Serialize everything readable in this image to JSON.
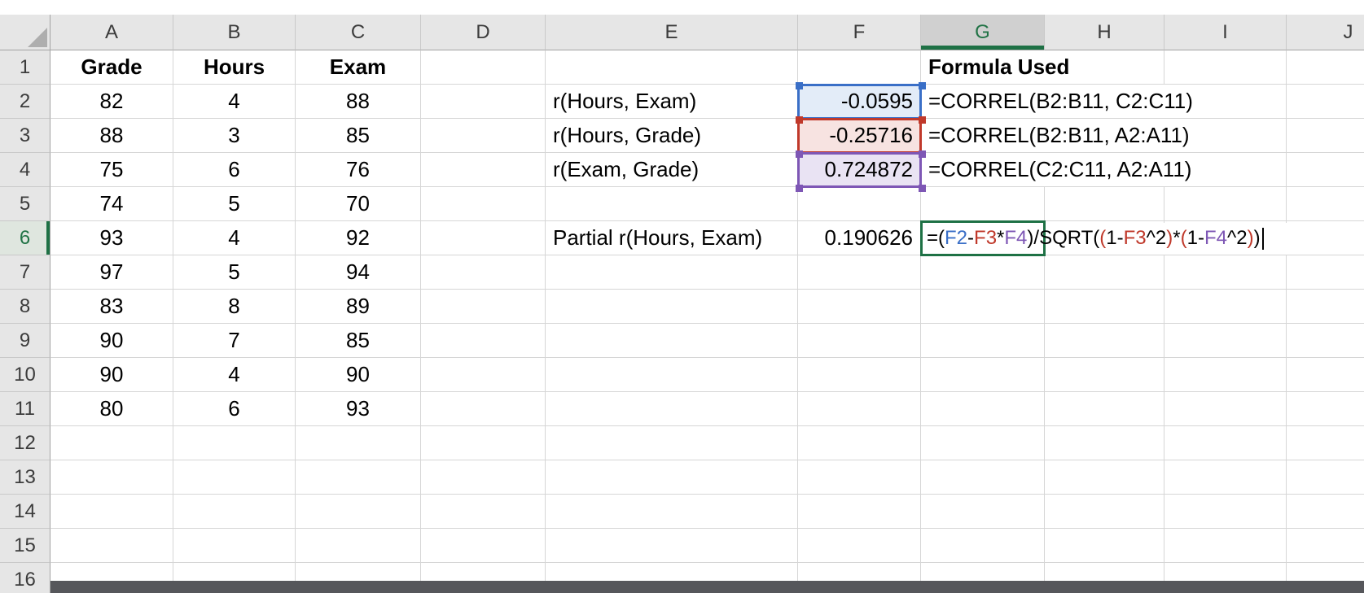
{
  "sheet": {
    "columns": [
      "A",
      "B",
      "C",
      "D",
      "E",
      "F",
      "G",
      "H",
      "I",
      "J"
    ],
    "rows": [
      "1",
      "2",
      "3",
      "4",
      "5",
      "6",
      "7",
      "8",
      "9",
      "10",
      "11",
      "12",
      "13",
      "14",
      "15",
      "16"
    ],
    "active_column": "G",
    "active_row": "6"
  },
  "cells": {
    "A1": "Grade",
    "B1": "Hours",
    "C1": "Exam",
    "G1": "Formula Used",
    "A2": "82",
    "A3": "88",
    "A4": "75",
    "A5": "74",
    "A6": "93",
    "A7": "97",
    "A8": "83",
    "A9": "90",
    "A10": "90",
    "A11": "80",
    "B2": "4",
    "B3": "3",
    "B4": "6",
    "B5": "5",
    "B6": "4",
    "B7": "5",
    "B8": "8",
    "B9": "7",
    "B10": "4",
    "B11": "6",
    "C2": "88",
    "C3": "85",
    "C4": "76",
    "C5": "70",
    "C6": "92",
    "C7": "94",
    "C8": "89",
    "C9": "85",
    "C10": "90",
    "C11": "93",
    "E2": "r(Hours, Exam)",
    "E3": "r(Hours, Grade)",
    "E4": "r(Exam, Grade)",
    "E6": "Partial r(Hours, Exam)",
    "F2": "-0.0595",
    "F3": "-0.25716",
    "F4": "0.724872",
    "F6": "0.190626",
    "G2": "=CORREL(B2:B11, C2:C11)",
    "G3": "=CORREL(B2:B11, A2:A11)",
    "G4": "=CORREL(C2:C11, A2:A11)"
  },
  "bold_cells": [
    "A1",
    "B1",
    "C1",
    "G1"
  ],
  "colors": {
    "ref_blue": "#3A6FC7",
    "ref_red": "#C0392B",
    "ref_purple": "#7E57B5",
    "edit_green": "#1E7145",
    "fill_blue": "#E3ECF8",
    "fill_red": "#F7E3E1",
    "fill_purple": "#E9E3F3"
  },
  "highlighted_ranges": [
    {
      "ref": "F2",
      "border": "#3A6FC7",
      "fill": "#E3ECF8"
    },
    {
      "ref": "F3",
      "border": "#C0392B",
      "fill": "#F7E3E1"
    },
    {
      "ref": "F4",
      "border": "#7E57B5",
      "fill": "#E9E3F3"
    }
  ],
  "edit_cell": {
    "ref": "G6",
    "formula_segments": [
      {
        "text": "=(",
        "color": "#000000"
      },
      {
        "text": "F2",
        "color": "#3A6FC7"
      },
      {
        "text": "-",
        "color": "#000000"
      },
      {
        "text": "F3",
        "color": "#C0392B"
      },
      {
        "text": "*",
        "color": "#000000"
      },
      {
        "text": "F4",
        "color": "#7E57B5"
      },
      {
        "text": ")/SQRT(",
        "color": "#000000"
      },
      {
        "text": "(",
        "color": "#C0392B"
      },
      {
        "text": "1-",
        "color": "#000000"
      },
      {
        "text": "F3",
        "color": "#C0392B"
      },
      {
        "text": "^2",
        "color": "#000000"
      },
      {
        "text": ")",
        "color": "#C0392B"
      },
      {
        "text": "*",
        "color": "#000000"
      },
      {
        "text": "(",
        "color": "#C0392B"
      },
      {
        "text": "1-",
        "color": "#000000"
      },
      {
        "text": "F4",
        "color": "#7E57B5"
      },
      {
        "text": "^2",
        "color": "#000000"
      },
      {
        "text": ")",
        "color": "#C0392B"
      },
      {
        "text": ")",
        "color": "#000000"
      }
    ]
  }
}
